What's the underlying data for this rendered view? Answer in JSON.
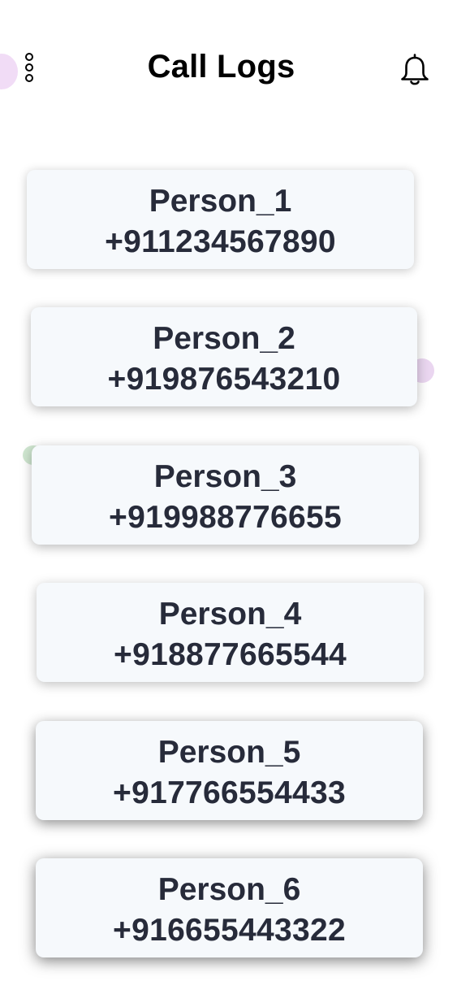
{
  "header": {
    "title": "Call Logs",
    "menu_icon": "more-vertical-icon",
    "notification_icon": "bell-icon"
  },
  "colors": {
    "background": "#ffffff",
    "card_background": "#f6f9fc",
    "text": "#272b3a",
    "title_text": "#000000",
    "accent_pink": "#f1dcf6",
    "accent_green": "#cfe6d0"
  },
  "call_logs": [
    {
      "name": "Person_1",
      "phone": "+911234567890"
    },
    {
      "name": "Person_2",
      "phone": "+919876543210"
    },
    {
      "name": "Person_3",
      "phone": "+919988776655"
    },
    {
      "name": "Person_4",
      "phone": "+918877665544"
    },
    {
      "name": "Person_5",
      "phone": "+917766554433"
    },
    {
      "name": "Person_6",
      "phone": "+916655443322"
    }
  ]
}
